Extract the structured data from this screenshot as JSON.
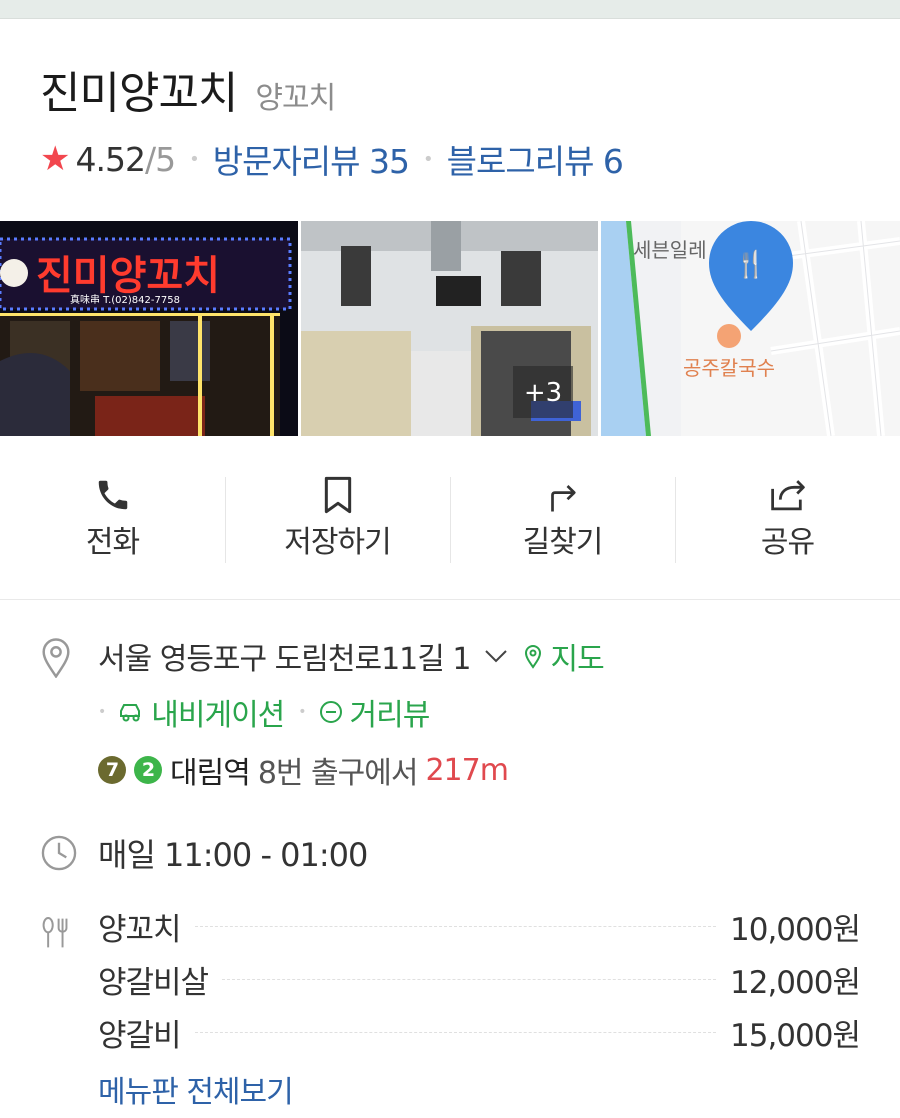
{
  "place": {
    "name": "진미양꼬치",
    "category": "양꼬치",
    "rating": "4.52",
    "rating_max": "/5",
    "visitor_review": "방문자리뷰 35",
    "blog_review": "블로그리뷰 6"
  },
  "photos": {
    "sign_text": "진미양꼬치",
    "sign_sub": "真味串  T.(02)842-7758",
    "more_count": "+3",
    "map_label_top": "세븐일레",
    "map_label_poi": "공주칼국수"
  },
  "actions": [
    {
      "label": "전화",
      "icon": "phone-icon"
    },
    {
      "label": "저장하기",
      "icon": "bookmark-icon"
    },
    {
      "label": "길찾기",
      "icon": "directions-icon"
    },
    {
      "label": "공유",
      "icon": "share-icon"
    }
  ],
  "info": {
    "address": "서울 영등포구 도림천로11길 1",
    "map_link": "지도",
    "navi_link": "내비게이션",
    "street_link": "거리뷰",
    "subway": {
      "lines": [
        "7",
        "2"
      ],
      "line_colors": [
        "#6b6a2f",
        "#3db54a"
      ],
      "station": "대림역",
      "exit_text": "8번 출구에서",
      "distance": "217m"
    },
    "hours": "매일 11:00 - 01:00",
    "menu": [
      {
        "name": "양꼬치",
        "price": "10,000원"
      },
      {
        "name": "양갈비살",
        "price": "12,000원"
      },
      {
        "name": "양갈비",
        "price": "15,000원"
      }
    ],
    "menu_link": "메뉴판 전체보기"
  }
}
